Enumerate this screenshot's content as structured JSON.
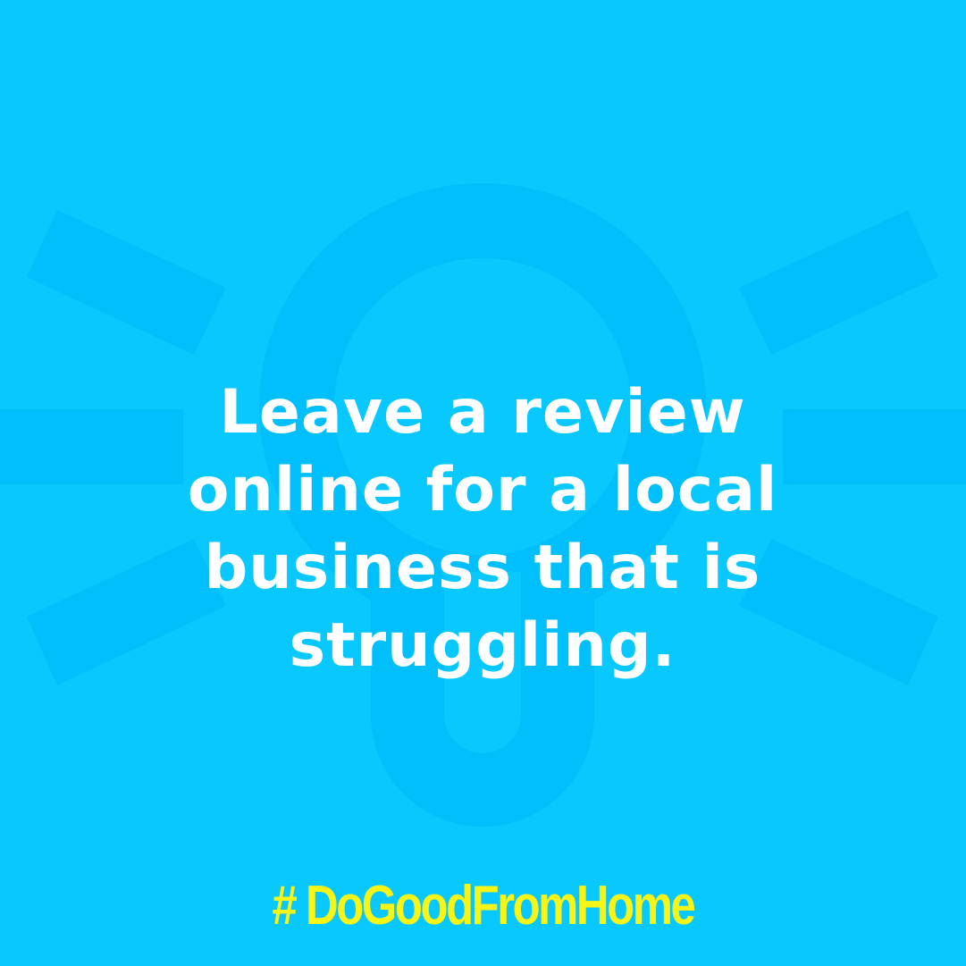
{
  "message": {
    "lines": [
      "Leave a review",
      "online for a local",
      "business that is",
      "struggling."
    ]
  },
  "hashtag": "# DoGoodFromHome",
  "colors": {
    "background": "#09c8fd",
    "bulb_graphic": "#00bffb",
    "message_text": "#ffffff",
    "hashtag_text": "#f7f417"
  },
  "graphic": {
    "icon": "lightbulb-icon"
  }
}
